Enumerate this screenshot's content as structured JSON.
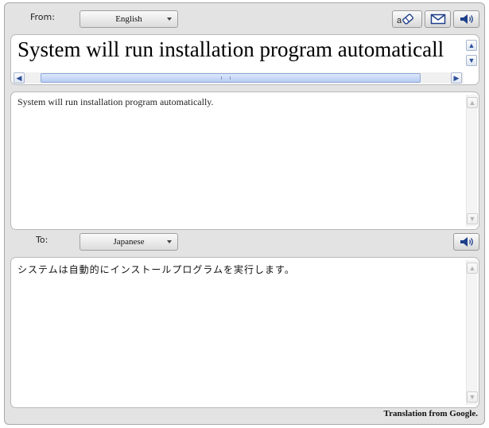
{
  "from": {
    "label": "From:",
    "language": "English"
  },
  "source": {
    "input_text": "System will run installation program automaticall",
    "body_text": "System will run installation program automatically."
  },
  "to": {
    "label": "To:",
    "language": "Japanese"
  },
  "result": {
    "body_text": "システムは自動的にインストールプログラムを実行します。"
  },
  "footer": {
    "attribution": "Translation from Google."
  },
  "icons": {
    "clear": "eraser-icon",
    "email": "envelope-icon",
    "speak": "speaker-icon"
  },
  "colors": {
    "panel_bg": "#e3e3e3",
    "scroll_accent": "#b8cdf3"
  }
}
